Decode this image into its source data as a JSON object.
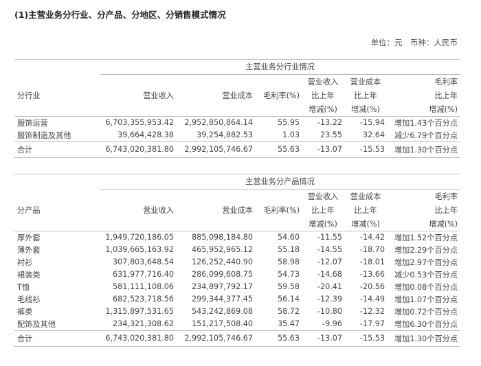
{
  "heading": "(1)主营业务分行业、分产品、分地区、分销售模式情况",
  "unit": "单位：元　币种：人民币",
  "headers": {
    "rev": "营业收入",
    "cost": "营业成本",
    "margin": "毛利率(%)",
    "rev_chg_1": "营业收入",
    "rev_chg_2": "比上年",
    "rev_chg_3": "增减(%)",
    "cost_chg_1": "营业成本",
    "cost_chg_2": "比上年",
    "cost_chg_3": "增减(%)",
    "margin_chg_1": "毛利率",
    "margin_chg_2": "比上年",
    "margin_chg_3": "增减(%)"
  },
  "industry": {
    "band": "主营业务分行业情况",
    "label": "分行业",
    "rows": [
      {
        "name": "服饰运营",
        "rev": "6,703,355,953.42",
        "cost": "2,952,850,864.14",
        "margin": "55.95",
        "rev_chg": "-13.22",
        "cost_chg": "-15.94",
        "margin_chg": "增加1.43个百分点"
      },
      {
        "name": "服饰制造及其他",
        "rev": "39,664,428.38",
        "cost": "39,254,882.53",
        "margin": "1.03",
        "rev_chg": "23.55",
        "cost_chg": "32.64",
        "margin_chg": "减少6.79个百分点"
      }
    ],
    "total": {
      "name": "合计",
      "rev": "6,743,020,381.80",
      "cost": "2,992,105,746.67",
      "margin": "55.63",
      "rev_chg": "-13.07",
      "cost_chg": "-15.53",
      "margin_chg": "增加1.30个百分点"
    }
  },
  "product": {
    "band": "主营业务分产品情况",
    "label": "分产品",
    "rows": [
      {
        "name": "厚外套",
        "rev": "1,949,720,186.05",
        "cost": "885,098,184.80",
        "margin": "54.60",
        "rev_chg": "-11.55",
        "cost_chg": "-14.42",
        "margin_chg": "增加1.52个百分点"
      },
      {
        "name": "薄外套",
        "rev": "1,039,665,163.92",
        "cost": "465,952,965.12",
        "margin": "55.18",
        "rev_chg": "-14.55",
        "cost_chg": "-18.70",
        "margin_chg": "增加2.29个百分点"
      },
      {
        "name": "衬衫",
        "rev": "307,803,648.54",
        "cost": "126,252,440.90",
        "margin": "58.98",
        "rev_chg": "-12.07",
        "cost_chg": "-18.01",
        "margin_chg": "增加2.97个百分点"
      },
      {
        "name": "裙装类",
        "rev": "631,977,716.40",
        "cost": "286,099,608.75",
        "margin": "54.73",
        "rev_chg": "-14.68",
        "cost_chg": "-13.66",
        "margin_chg": "减少0.53个百分点"
      },
      {
        "name": "T恤",
        "rev": "581,111,108.06",
        "cost": "234,897,792.17",
        "margin": "59.58",
        "rev_chg": "-20.41",
        "cost_chg": "-20.56",
        "margin_chg": "增加0.08个百分点"
      },
      {
        "name": "毛线衫",
        "rev": "682,523,718.56",
        "cost": "299,344,377.45",
        "margin": "56.14",
        "rev_chg": "-12.39",
        "cost_chg": "-14.49",
        "margin_chg": "增加1.07个百分点"
      },
      {
        "name": "裤类",
        "rev": "1,315,897,531.65",
        "cost": "543,242,869.08",
        "margin": "58.72",
        "rev_chg": "-10.80",
        "cost_chg": "-12.32",
        "margin_chg": "增加0.72个百分点"
      },
      {
        "name": "配饰及其他",
        "rev": "234,321,308.62",
        "cost": "151,217,508.40",
        "margin": "35.47",
        "rev_chg": "-9.96",
        "cost_chg": "-17.97",
        "margin_chg": "增加6.30个百分点"
      }
    ],
    "total": {
      "name": "合计",
      "rev": "6,743,020,381.80",
      "cost": "2,992,105,746.67",
      "margin": "55.63",
      "rev_chg": "-13.07",
      "cost_chg": "-15.53",
      "margin_chg": "增加1.30个百分点"
    }
  }
}
